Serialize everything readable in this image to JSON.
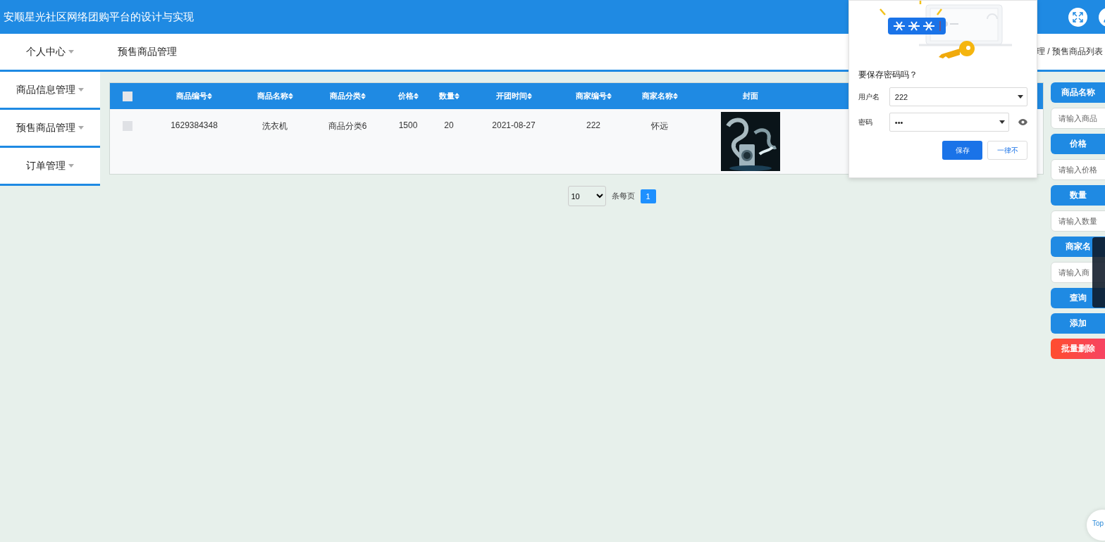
{
  "header": {
    "title": "安顺星光社区网络团购平台的设计与实现"
  },
  "nav": {
    "user_menu": "个人中心",
    "page_title": "预售商品管理",
    "breadcrumb": "理 / 预售商品列表"
  },
  "sidebar": {
    "items": [
      {
        "label": "商品信息管理",
        "selected": false
      },
      {
        "label": "预售商品管理",
        "selected": false
      },
      {
        "label": "订单管理",
        "selected": false
      }
    ]
  },
  "table": {
    "select_all": {
      "checked": false
    },
    "columns": [
      {
        "label": "商品编号",
        "sortable": true
      },
      {
        "label": "商品名称",
        "sortable": true
      },
      {
        "label": "商品分类",
        "sortable": true
      },
      {
        "label": "价格",
        "sortable": true
      },
      {
        "label": "数量",
        "sortable": true
      },
      {
        "label": "开团时间",
        "sortable": true
      },
      {
        "label": "商家编号",
        "sortable": true
      },
      {
        "label": "商家名称",
        "sortable": true
      },
      {
        "label": "封面",
        "sortable": false
      }
    ],
    "rows": [
      {
        "checked": false,
        "cells": [
          "1629384348",
          "洗衣机",
          "商品分类6",
          "1500",
          "20",
          "2021-08-27",
          "222",
          "怀远"
        ],
        "cover": {
          "kind": "picture"
        }
      }
    ]
  },
  "pagination": {
    "page_size": "10",
    "per_page_label": "条每页",
    "pages": [
      {
        "label": "1",
        "selected": true
      }
    ]
  },
  "search_panel": {
    "items": [
      {
        "kind": "label",
        "text": "商品名称"
      },
      {
        "kind": "input",
        "placeholder": "请输入商品"
      },
      {
        "kind": "label",
        "text": "价格"
      },
      {
        "kind": "input",
        "placeholder": "请输入价格"
      },
      {
        "kind": "label",
        "text": "数量"
      },
      {
        "kind": "input",
        "placeholder": "请输入数量"
      },
      {
        "kind": "label",
        "text": "商家名"
      },
      {
        "kind": "input",
        "placeholder": "请输入商"
      },
      {
        "kind": "button",
        "text": "查询"
      },
      {
        "kind": "button",
        "text": "添加"
      },
      {
        "kind": "danger",
        "text": "批量删除"
      }
    ]
  },
  "save_password_popup": {
    "title": "要保存密码吗？",
    "username_label": "用户名",
    "username": "222",
    "password_label": "密码",
    "password": "•••",
    "save_button": "保存",
    "never_button": "一律不"
  },
  "back_to_top": "Top"
}
